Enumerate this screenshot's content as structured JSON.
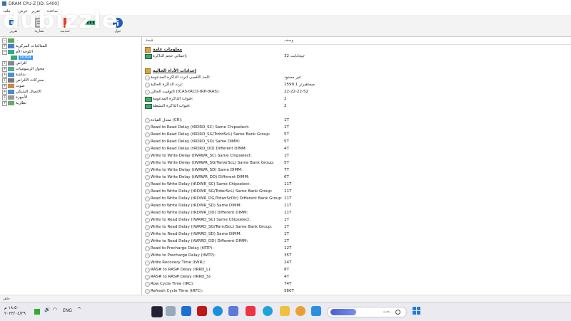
{
  "window": {
    "title": "DRAM CPU-Z [ID: 5400]"
  },
  "menu": {
    "items": [
      "ملف",
      "عرض",
      "تقرير",
      "مساعدة"
    ]
  },
  "toolbar": {
    "buttons": [
      {
        "label": "تقرير",
        "icon": "report-icon"
      },
      {
        "label": "مقارنة",
        "icon": "compare-icon"
      },
      {
        "label": "تحديث",
        "icon": "refresh-icon"
      },
      {
        "label": "حول",
        "icon": "info-icon"
      }
    ]
  },
  "tree": {
    "nodes": [
      {
        "label": "...",
        "sel": false
      },
      {
        "label": "المعالجات المركزية",
        "sel": false
      },
      {
        "label": "اللوحة الأم",
        "sel": false
      },
      {
        "label": "DDR4",
        "sel": true
      },
      {
        "label": "أقراص",
        "sel": false
      },
      {
        "label": "محول الرسوميات",
        "sel": false
      },
      {
        "label": "شاشة",
        "sel": false
      },
      {
        "label": "محركات الأقراص",
        "sel": false
      },
      {
        "label": "صوت",
        "sel": false
      },
      {
        "label": "الاتصال الشبكي",
        "sel": false
      },
      {
        "label": "الأجهزة",
        "sel": false
      },
      {
        "label": "بطارية",
        "sel": false
      }
    ]
  },
  "content": {
    "headers": {
      "field": "قيمة",
      "value": "وصف"
    },
    "section_general": "معلومات عامة",
    "general_rows": [
      {
        "field": "إجمالي حجم الذاكرة:",
        "value": "32 جيجابايت"
      }
    ],
    "section_current": "إعدادات الأداء الحالية",
    "current_rows": [
      {
        "field": "الحد الأقصى لتردد الذاكرة المدعومة:",
        "value": "غير محدود"
      },
      {
        "field": "تردد الذاكرة الحالية:",
        "value": "1599.1 ميجاهيرتز"
      },
      {
        "field": "التوقيت الحالي (tCAS-tRCD-tRP-tRAS):",
        "value": "22-22-22-52"
      },
      {
        "field": "قنوات الذاكرة المدعومة:",
        "value": "2"
      },
      {
        "field": "قنوات الذاكرة النشطة:",
        "value": "2"
      }
    ],
    "timing_rows": [
      {
        "field": "معدل القيادة (CR):",
        "value": "1T"
      },
      {
        "field": "Read to Read Delay (tRDRD_SC) Same Chipselect:",
        "value": "1T"
      },
      {
        "field": "Read to Read Delay (tRDRD_SG/TrdrdScL) Same Bank Group:",
        "value": "5T"
      },
      {
        "field": "Read to Read Delay (tRDRD_SD) Same DIMM:",
        "value": "5T"
      },
      {
        "field": "Read to Read Delay (tRDRD_DD) Different DIMM:",
        "value": "4T"
      },
      {
        "field": "Write to Write Delay (tWRWR_SC) Same Chipselect:",
        "value": "1T"
      },
      {
        "field": "Write to Write Delay (tWRWR_SG/TwrwrScL) Same Bank Group:",
        "value": "5T"
      },
      {
        "field": "Write to Write Delay (tWRWR_SD) Same DIMM:",
        "value": "7T"
      },
      {
        "field": "Write to Write Delay (tWRWR_DD) Different DIMM:",
        "value": "6T"
      },
      {
        "field": "Read to Write Delay (tRDWR_SC) Same Chipselect:",
        "value": "11T"
      },
      {
        "field": "Read to Write Delay (tRDWR_SG/TrdwrScL) Same Bank Group:",
        "value": "11T"
      },
      {
        "field": "Read to Write Delay (tRDWR_DG/TrdwrScDlr) Different Bank Group:",
        "value": "11T"
      },
      {
        "field": "Read to Write Delay (tRDWR_SD) Same DIMM:",
        "value": "11T"
      },
      {
        "field": "Read to Write Delay (tRDWR_DD) Different DIMM:",
        "value": "11T"
      },
      {
        "field": "Write to Read Delay (tWRRD_SC) Same Chipselect:",
        "value": "1T"
      },
      {
        "field": "Write to Read Delay (tWRRD_SG/TwrrdScL) Same Bank Group:",
        "value": "1T"
      },
      {
        "field": "Write to Read Delay (tWRRD_SD) Same DIMM:",
        "value": "1T"
      },
      {
        "field": "Write to Read Delay (tWRRD_DD) Different DIMM:",
        "value": "1T"
      },
      {
        "field": "Read to Precharge Delay (tRTP):",
        "value": "12T"
      },
      {
        "field": "Write to Precharge Delay (tWTP):",
        "value": "35T"
      },
      {
        "field": "Write Recovery Time (tWR):",
        "value": "24T"
      },
      {
        "field": "RAS# to RAS# Delay (tRRD_L):",
        "value": "8T"
      },
      {
        "field": "RAS# to RAS# Delay (tRRD_S):",
        "value": "4T"
      },
      {
        "field": "Row Cycle Time (tRC):",
        "value": "74T"
      },
      {
        "field": "Refresh Cycle Time (tRFC):",
        "value": "560T"
      }
    ]
  },
  "status": {
    "text": "جاهز"
  },
  "taskbar": {
    "time": "١٨:٥٠ م",
    "date": "٢٠٢٣/٠٤/٢٩",
    "lang": "ENG",
    "search_placeholder": "بحث"
  },
  "watermark": {
    "text": "dubizzle"
  }
}
